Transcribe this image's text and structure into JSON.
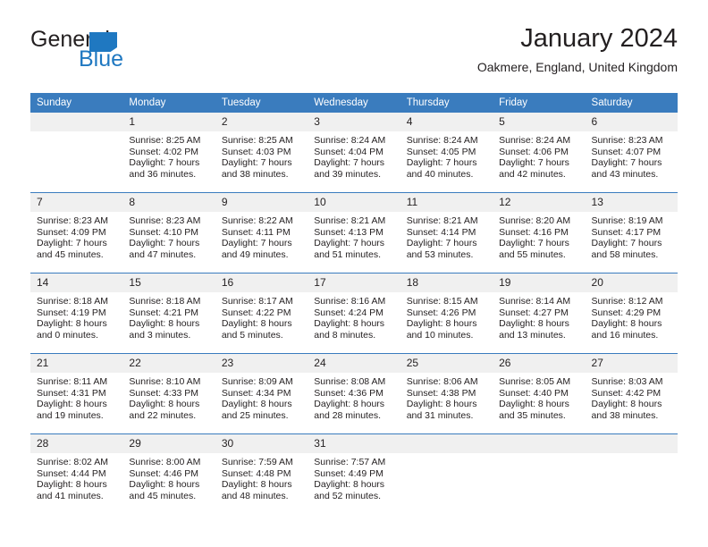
{
  "brand": {
    "name_part1": "General",
    "name_part2": "Blue",
    "logo_icon": "triangle-flag-icon",
    "color_primary": "#1f78c1",
    "color_text": "#231f20"
  },
  "header": {
    "title": "January 2024",
    "subtitle": "Oakmere, England, United Kingdom"
  },
  "theme": {
    "header_blue": "#3a7cbe",
    "daynum_bg": "#f0f0f0",
    "text": "#231f20"
  },
  "calendar": {
    "weekday_headers": [
      "Sunday",
      "Monday",
      "Tuesday",
      "Wednesday",
      "Thursday",
      "Friday",
      "Saturday"
    ],
    "weeks": [
      [
        {
          "day": "",
          "info": ""
        },
        {
          "day": "1",
          "info": "Sunrise: 8:25 AM\nSunset: 4:02 PM\nDaylight: 7 hours\nand 36 minutes."
        },
        {
          "day": "2",
          "info": "Sunrise: 8:25 AM\nSunset: 4:03 PM\nDaylight: 7 hours\nand 38 minutes."
        },
        {
          "day": "3",
          "info": "Sunrise: 8:24 AM\nSunset: 4:04 PM\nDaylight: 7 hours\nand 39 minutes."
        },
        {
          "day": "4",
          "info": "Sunrise: 8:24 AM\nSunset: 4:05 PM\nDaylight: 7 hours\nand 40 minutes."
        },
        {
          "day": "5",
          "info": "Sunrise: 8:24 AM\nSunset: 4:06 PM\nDaylight: 7 hours\nand 42 minutes."
        },
        {
          "day": "6",
          "info": "Sunrise: 8:23 AM\nSunset: 4:07 PM\nDaylight: 7 hours\nand 43 minutes."
        }
      ],
      [
        {
          "day": "7",
          "info": "Sunrise: 8:23 AM\nSunset: 4:09 PM\nDaylight: 7 hours\nand 45 minutes."
        },
        {
          "day": "8",
          "info": "Sunrise: 8:23 AM\nSunset: 4:10 PM\nDaylight: 7 hours\nand 47 minutes."
        },
        {
          "day": "9",
          "info": "Sunrise: 8:22 AM\nSunset: 4:11 PM\nDaylight: 7 hours\nand 49 minutes."
        },
        {
          "day": "10",
          "info": "Sunrise: 8:21 AM\nSunset: 4:13 PM\nDaylight: 7 hours\nand 51 minutes."
        },
        {
          "day": "11",
          "info": "Sunrise: 8:21 AM\nSunset: 4:14 PM\nDaylight: 7 hours\nand 53 minutes."
        },
        {
          "day": "12",
          "info": "Sunrise: 8:20 AM\nSunset: 4:16 PM\nDaylight: 7 hours\nand 55 minutes."
        },
        {
          "day": "13",
          "info": "Sunrise: 8:19 AM\nSunset: 4:17 PM\nDaylight: 7 hours\nand 58 minutes."
        }
      ],
      [
        {
          "day": "14",
          "info": "Sunrise: 8:18 AM\nSunset: 4:19 PM\nDaylight: 8 hours\nand 0 minutes."
        },
        {
          "day": "15",
          "info": "Sunrise: 8:18 AM\nSunset: 4:21 PM\nDaylight: 8 hours\nand 3 minutes."
        },
        {
          "day": "16",
          "info": "Sunrise: 8:17 AM\nSunset: 4:22 PM\nDaylight: 8 hours\nand 5 minutes."
        },
        {
          "day": "17",
          "info": "Sunrise: 8:16 AM\nSunset: 4:24 PM\nDaylight: 8 hours\nand 8 minutes."
        },
        {
          "day": "18",
          "info": "Sunrise: 8:15 AM\nSunset: 4:26 PM\nDaylight: 8 hours\nand 10 minutes."
        },
        {
          "day": "19",
          "info": "Sunrise: 8:14 AM\nSunset: 4:27 PM\nDaylight: 8 hours\nand 13 minutes."
        },
        {
          "day": "20",
          "info": "Sunrise: 8:12 AM\nSunset: 4:29 PM\nDaylight: 8 hours\nand 16 minutes."
        }
      ],
      [
        {
          "day": "21",
          "info": "Sunrise: 8:11 AM\nSunset: 4:31 PM\nDaylight: 8 hours\nand 19 minutes."
        },
        {
          "day": "22",
          "info": "Sunrise: 8:10 AM\nSunset: 4:33 PM\nDaylight: 8 hours\nand 22 minutes."
        },
        {
          "day": "23",
          "info": "Sunrise: 8:09 AM\nSunset: 4:34 PM\nDaylight: 8 hours\nand 25 minutes."
        },
        {
          "day": "24",
          "info": "Sunrise: 8:08 AM\nSunset: 4:36 PM\nDaylight: 8 hours\nand 28 minutes."
        },
        {
          "day": "25",
          "info": "Sunrise: 8:06 AM\nSunset: 4:38 PM\nDaylight: 8 hours\nand 31 minutes."
        },
        {
          "day": "26",
          "info": "Sunrise: 8:05 AM\nSunset: 4:40 PM\nDaylight: 8 hours\nand 35 minutes."
        },
        {
          "day": "27",
          "info": "Sunrise: 8:03 AM\nSunset: 4:42 PM\nDaylight: 8 hours\nand 38 minutes."
        }
      ],
      [
        {
          "day": "28",
          "info": "Sunrise: 8:02 AM\nSunset: 4:44 PM\nDaylight: 8 hours\nand 41 minutes."
        },
        {
          "day": "29",
          "info": "Sunrise: 8:00 AM\nSunset: 4:46 PM\nDaylight: 8 hours\nand 45 minutes."
        },
        {
          "day": "30",
          "info": "Sunrise: 7:59 AM\nSunset: 4:48 PM\nDaylight: 8 hours\nand 48 minutes."
        },
        {
          "day": "31",
          "info": "Sunrise: 7:57 AM\nSunset: 4:49 PM\nDaylight: 8 hours\nand 52 minutes."
        },
        {
          "day": "",
          "info": ""
        },
        {
          "day": "",
          "info": ""
        },
        {
          "day": "",
          "info": ""
        }
      ]
    ]
  }
}
